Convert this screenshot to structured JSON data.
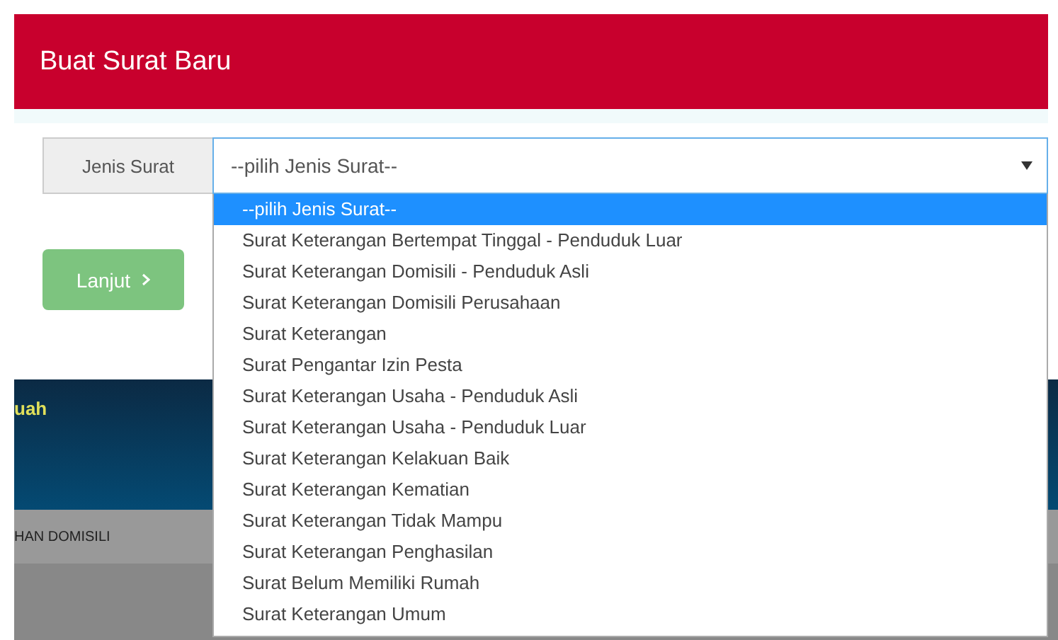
{
  "modal": {
    "title": "Buat Surat Baru"
  },
  "form": {
    "label": "Jenis Surat",
    "select_value": "--pilih Jenis Surat--",
    "dropdown_open": true
  },
  "options": [
    {
      "label": "--pilih Jenis Surat--",
      "selected": true
    },
    {
      "label": "Surat Keterangan Bertempat Tinggal - Penduduk Luar",
      "selected": false
    },
    {
      "label": "Surat Keterangan Domisili - Penduduk Asli",
      "selected": false
    },
    {
      "label": "Surat Keterangan Domisili Perusahaan",
      "selected": false
    },
    {
      "label": "Surat Keterangan",
      "selected": false
    },
    {
      "label": "Surat Pengantar Izin Pesta",
      "selected": false
    },
    {
      "label": "Surat Keterangan Usaha - Penduduk Asli",
      "selected": false
    },
    {
      "label": "Surat Keterangan Usaha - Penduduk Luar",
      "selected": false
    },
    {
      "label": "Surat Keterangan Kelakuan Baik",
      "selected": false
    },
    {
      "label": "Surat Keterangan Kematian",
      "selected": false
    },
    {
      "label": "Surat Keterangan Tidak Mampu",
      "selected": false
    },
    {
      "label": "Surat Keterangan Penghasilan",
      "selected": false
    },
    {
      "label": "Surat Belum Memiliki Rumah",
      "selected": false
    },
    {
      "label": "Surat Keterangan Umum",
      "selected": false
    }
  ],
  "button": {
    "label": "Lanjut"
  },
  "background": {
    "header_text": "uah",
    "row_text": "HAN DOMISILI"
  }
}
